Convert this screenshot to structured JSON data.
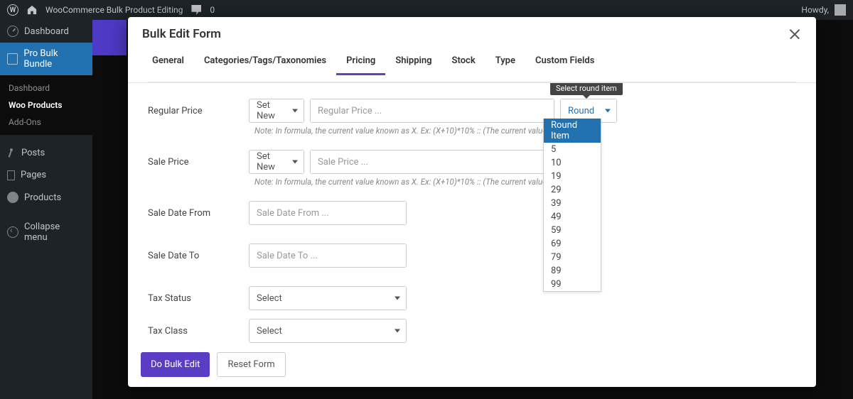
{
  "wp_admin_bar": {
    "site_title": "WooCommerce Bulk Product Editing",
    "comment_count": "0",
    "howdy": "Howdy,"
  },
  "wp_sidebar": {
    "dashboard": "Dashboard",
    "pro_bulk": "Pro Bulk Bundle",
    "submenu": {
      "dashboard": "Dashboard",
      "woo_products": "Woo Products",
      "add_ons": "Add-Ons"
    },
    "posts": "Posts",
    "pages": "Pages",
    "products": "Products",
    "collapse": "Collapse menu"
  },
  "modal": {
    "title": "Bulk Edit Form",
    "tabs": {
      "general": "General",
      "categories": "Categories/Tags/Taxonomies",
      "pricing": "Pricing",
      "shipping": "Shipping",
      "stock": "Stock",
      "type": "Type",
      "custom_fields": "Custom Fields"
    },
    "tooltip_round": "Select round item",
    "fields": {
      "regular_price": {
        "label": "Regular Price",
        "action": "Set New",
        "placeholder": "Regular Price ...",
        "round": "Round Item",
        "note": "Note: In formula, the current value known as X. Ex: (X+10)*10% :: (The current value"
      },
      "sale_price": {
        "label": "Sale Price",
        "action": "Set New",
        "placeholder": "Sale Price ...",
        "note": "Note: In formula, the current value known as X. Ex: (X+10)*10% :: (The current value"
      },
      "sale_date_from": {
        "label": "Sale Date From",
        "placeholder": "Sale Date From ..."
      },
      "sale_date_to": {
        "label": "Sale Date To",
        "placeholder": "Sale Date To ..."
      },
      "tax_status": {
        "label": "Tax Status",
        "value": "Select"
      },
      "tax_class": {
        "label": "Tax Class",
        "value": "Select"
      }
    },
    "round_dropdown": {
      "items": [
        "Round Item",
        "5",
        "10",
        "19",
        "29",
        "39",
        "49",
        "59",
        "69",
        "79",
        "89",
        "99"
      ]
    },
    "footer": {
      "do_bulk": "Do Bulk Edit",
      "reset": "Reset Form"
    }
  }
}
